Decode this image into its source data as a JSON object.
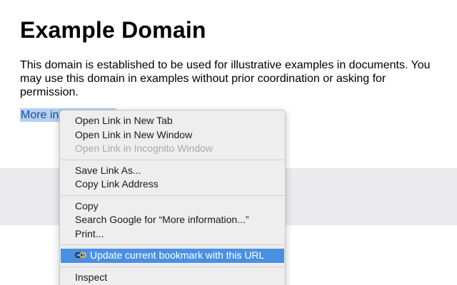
{
  "page": {
    "title": "Example Domain",
    "body": "This domain is established to be used for illustrative examples in documents. You may use this domain in examples without prior coordination or asking for permission.",
    "link_text": "More information..."
  },
  "context_menu": {
    "groups": [
      [
        {
          "label": "Open Link in New Tab",
          "enabled": true
        },
        {
          "label": "Open Link in New Window",
          "enabled": true
        },
        {
          "label": "Open Link in Incognito Window",
          "enabled": false
        }
      ],
      [
        {
          "label": "Save Link As...",
          "enabled": true
        },
        {
          "label": "Copy Link Address",
          "enabled": true
        }
      ],
      [
        {
          "label": "Copy",
          "enabled": true
        },
        {
          "label": "Search Google for “More information...”",
          "enabled": true
        },
        {
          "label": "Print...",
          "enabled": true
        }
      ],
      [
        {
          "label": "Update current bookmark with this URL",
          "enabled": true,
          "highlighted": true,
          "icon": "link-chain-icon"
        }
      ],
      [
        {
          "label": "Inspect",
          "enabled": true
        }
      ]
    ]
  },
  "colors": {
    "highlight": "#4a90e2",
    "link": "#1a4e9a",
    "selection": "#b4cff1",
    "menu_background": "#eeeeee",
    "band": "#ebebed"
  }
}
